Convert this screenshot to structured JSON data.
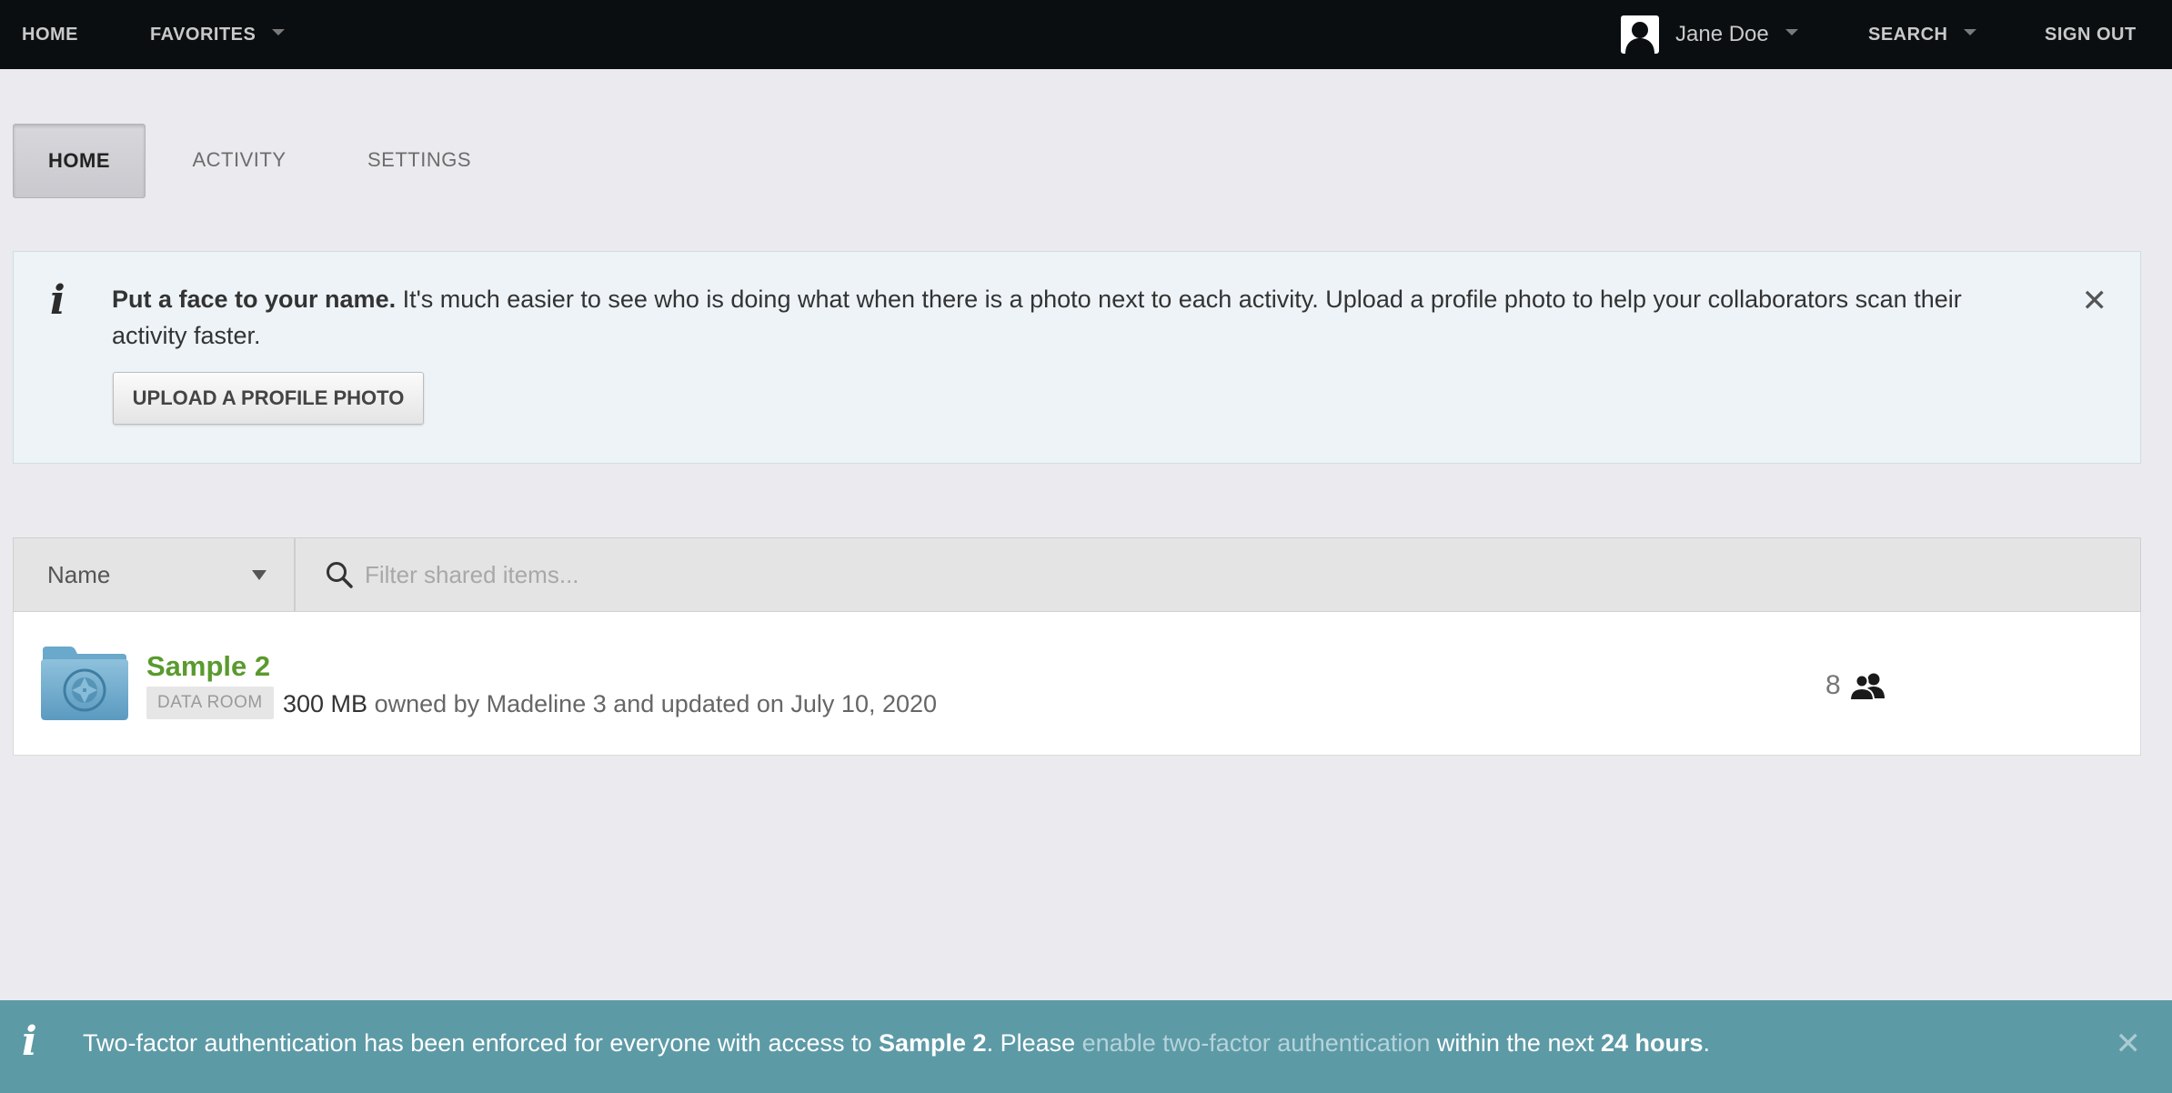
{
  "topbar": {
    "home_label": "HOME",
    "favorites_label": "FAVORITES",
    "user_name": "Jane Doe",
    "search_label": "SEARCH",
    "sign_out_label": "SIGN OUT"
  },
  "tabs": [
    {
      "label": "HOME",
      "active": true
    },
    {
      "label": "ACTIVITY",
      "active": false
    },
    {
      "label": "SETTINGS",
      "active": false
    }
  ],
  "info_panel": {
    "icon": "info-icon",
    "title": "Put a face to your name.",
    "body": " It's much easier to see who is doing what when there is a photo next to each activity. Upload a profile photo to help your collaborators scan their activity faster.",
    "button_label": "UPLOAD A PROFILE PHOTO",
    "close_glyph": "✕"
  },
  "filter": {
    "sort_label": "Name",
    "search_placeholder": "Filter shared items..."
  },
  "items": [
    {
      "name": "Sample 2",
      "badge": "DATA ROOM",
      "size": "300 MB",
      "meta": " owned by Madeline 3 and updated on July 10, 2020",
      "member_count": "8"
    }
  ],
  "banner": {
    "text_1": "Two-factor authentication has been enforced for everyone with access to ",
    "room_name": "Sample 2",
    "text_2": ". Please ",
    "link_text": "enable two-factor authentication",
    "text_3": " within the next ",
    "deadline": "24 hours",
    "text_4": ".",
    "close_glyph": "✕"
  },
  "colors": {
    "topbar_bg": "#0b0e10",
    "item_name": "#5a9a2e",
    "banner_bg": "#5c9aa6",
    "info_panel_bg": "#edf3f7"
  }
}
